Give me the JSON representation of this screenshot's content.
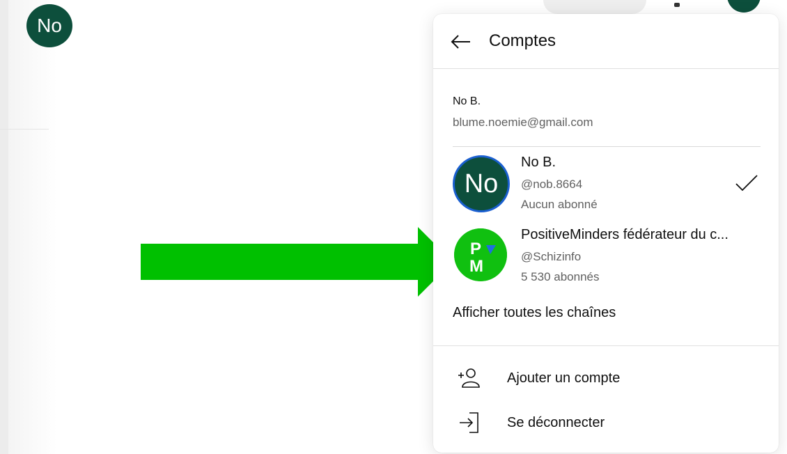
{
  "background": {
    "avatar_initials": "No"
  },
  "menu": {
    "title": "Comptes",
    "back_icon": "arrow-left-icon",
    "current_account": {
      "name": "No B.",
      "email": "blume.noemie@gmail.com"
    },
    "channels": [
      {
        "avatar_initials": "No",
        "name": "No B.",
        "handle": "@nob.8664",
        "subscribers": "Aucun abonné",
        "selected": true
      },
      {
        "avatar_letters": [
          "P",
          "M"
        ],
        "name": "PositiveMinders fédérateur du c...",
        "handle": "@Schizinfo",
        "subscribers": "5 530 abonnés",
        "selected": false
      }
    ],
    "show_all_channels": "Afficher toutes les chaînes",
    "actions": [
      {
        "label": "Ajouter un compte",
        "icon": "add-account-icon"
      },
      {
        "label": "Se déconnecter",
        "icon": "sign-out-icon"
      }
    ]
  },
  "colors": {
    "avatar_green": "#0d4f3c",
    "avatar_ring": "#1a5fd0",
    "pm_green": "#10c010",
    "pm_blue": "#1e6fe0",
    "arrow_green": "#00c000",
    "text_primary": "#0f0f0f",
    "text_secondary": "#606060"
  }
}
